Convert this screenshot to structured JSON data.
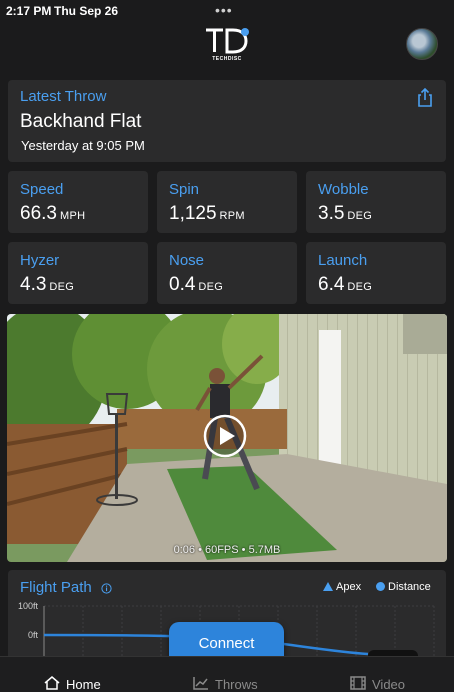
{
  "status_bar": {
    "time": "2:17 PM",
    "date": "Thu Sep 26",
    "dots": "•••"
  },
  "header": {
    "logo_text": "TECHDISC"
  },
  "latest_throw": {
    "label": "Latest Throw",
    "title": "Backhand Flat",
    "timestamp": "Yesterday at 9:05 PM"
  },
  "metrics": [
    {
      "label": "Speed",
      "value": "66.3",
      "unit": "MPH"
    },
    {
      "label": "Spin",
      "value": "1,125",
      "unit": "RPM"
    },
    {
      "label": "Wobble",
      "value": "3.5",
      "unit": "DEG"
    },
    {
      "label": "Hyzer",
      "value": "4.3",
      "unit": "DEG"
    },
    {
      "label": "Nose",
      "value": "0.4",
      "unit": "DEG"
    },
    {
      "label": "Launch",
      "value": "6.4",
      "unit": "DEG"
    }
  ],
  "video": {
    "meta": "0:06 • 60FPS • 5.7MB"
  },
  "flight_path": {
    "title": "Flight Path",
    "legend_apex": "Apex",
    "legend_distance": "Distance",
    "ytick_top": "100ft",
    "ytick_mid": "0ft"
  },
  "connect_button": {
    "label": "Connect"
  },
  "tabs": [
    {
      "label": "Home",
      "icon": "home-icon",
      "active": true
    },
    {
      "label": "Throws",
      "icon": "chart-icon",
      "active": false
    },
    {
      "label": "Video",
      "icon": "film-icon",
      "active": false
    }
  ],
  "colors": {
    "accent": "#4a9ff0",
    "card": "#2b2b2c",
    "background": "#1b1b1c",
    "button": "#2d84db"
  }
}
